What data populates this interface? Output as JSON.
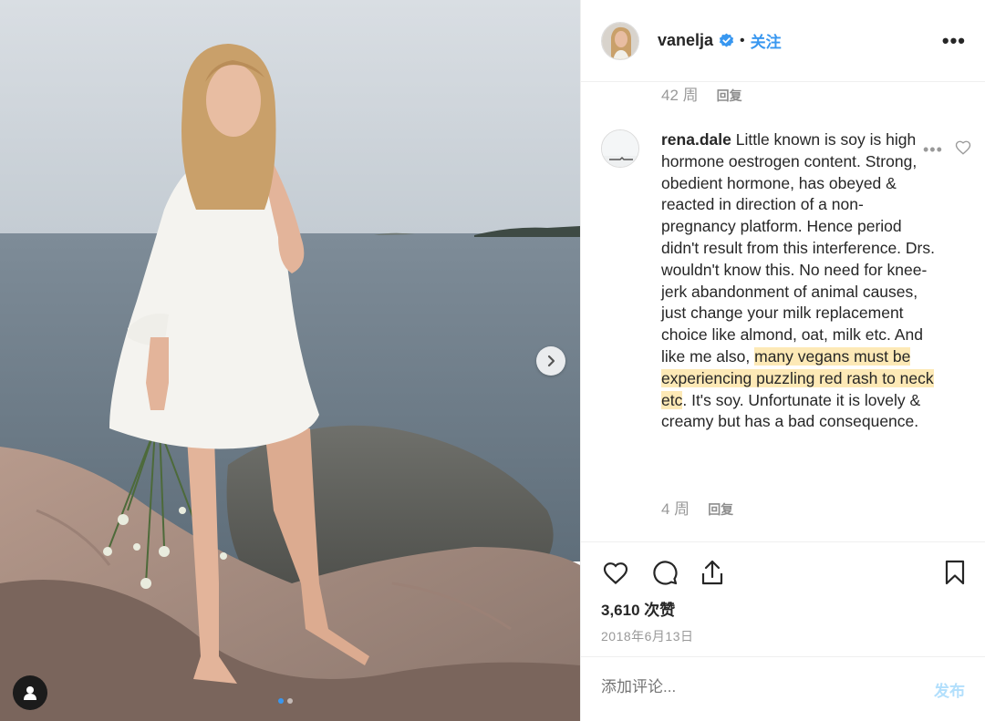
{
  "post": {
    "owner_username": "vanelja",
    "follow_label": "关注",
    "bullet": "•",
    "verified": true,
    "more_glyph": "•••",
    "carousel_count": 2,
    "carousel_active": 1
  },
  "prev_comment": {
    "age": "42 周",
    "reply_label": "回复"
  },
  "comment": {
    "username": "rena.dale",
    "text_before": " Little known is soy is high hormone oestrogen content. Strong, obedient hormone, has obeyed & reacted in direction of a non-pregnancy platform. Hence period didn't result from this interference. Drs. wouldn't know this. No need for knee-jerk abandonment of animal causes, just change your milk replacement choice like almond, oat, milk etc. And like me also, ",
    "text_highlight": "many vegans must be experiencing puzzling red rash to neck etc",
    "text_after": ". It's soy. Unfortunate it is lovely & creamy but has a bad consequence.",
    "age": "4 周",
    "reply_label": "回复",
    "more_glyph": "•••"
  },
  "stats": {
    "likes": "3,610 次赞",
    "date": "2018年6月13日"
  },
  "composer": {
    "placeholder": "添加评论...",
    "post_label": "发布"
  },
  "colors": {
    "accent": "#3897f0",
    "highlight": "#fde9b6",
    "muted": "#999999",
    "post_disabled": "#b2dffc"
  },
  "icons": [
    "verified-badge-icon",
    "more-options-icon",
    "heart-icon",
    "comment-icon",
    "share-icon",
    "bookmark-icon",
    "chevron-right-icon",
    "user-tag-icon"
  ]
}
